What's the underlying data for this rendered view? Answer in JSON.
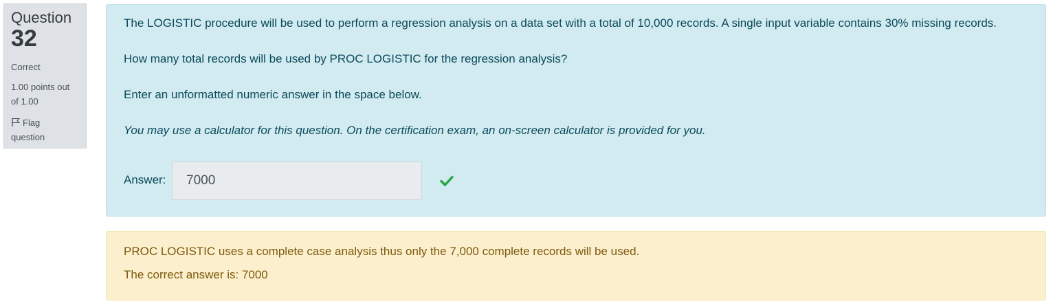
{
  "info": {
    "question_label": "Question",
    "question_number": "32",
    "state": "Correct",
    "grade_line1": "1.00 points out",
    "grade_line2": "of 1.00",
    "flag_line1": "Flag",
    "flag_line2": "question",
    "flag_icon": "flag-icon"
  },
  "question": {
    "paragraph1": "The LOGISTIC procedure will be used to perform a regression analysis on a data set with a total of 10,000 records. A single input variable contains 30% missing records.",
    "paragraph2": "How many total records will be used by PROC LOGISTIC for the regression analysis?",
    "paragraph3": "Enter an unformatted numeric answer in the space below.",
    "paragraph4": "You may use a calculator for this question. On the certification exam, an on-screen calculator is provided for you.",
    "answer_label": "Answer:",
    "answer_value": "7000",
    "result_icon": "check-icon"
  },
  "feedback": {
    "explanation": "PROC LOGISTIC uses a complete case analysis thus only the 7,000 complete records will be used.",
    "correct_answer": "The correct answer is: 7000"
  },
  "colors": {
    "question_bg": "#d1ebf0",
    "feedback_bg": "#fcefcd",
    "info_bg": "#dee2e6",
    "check": "#28a745"
  }
}
